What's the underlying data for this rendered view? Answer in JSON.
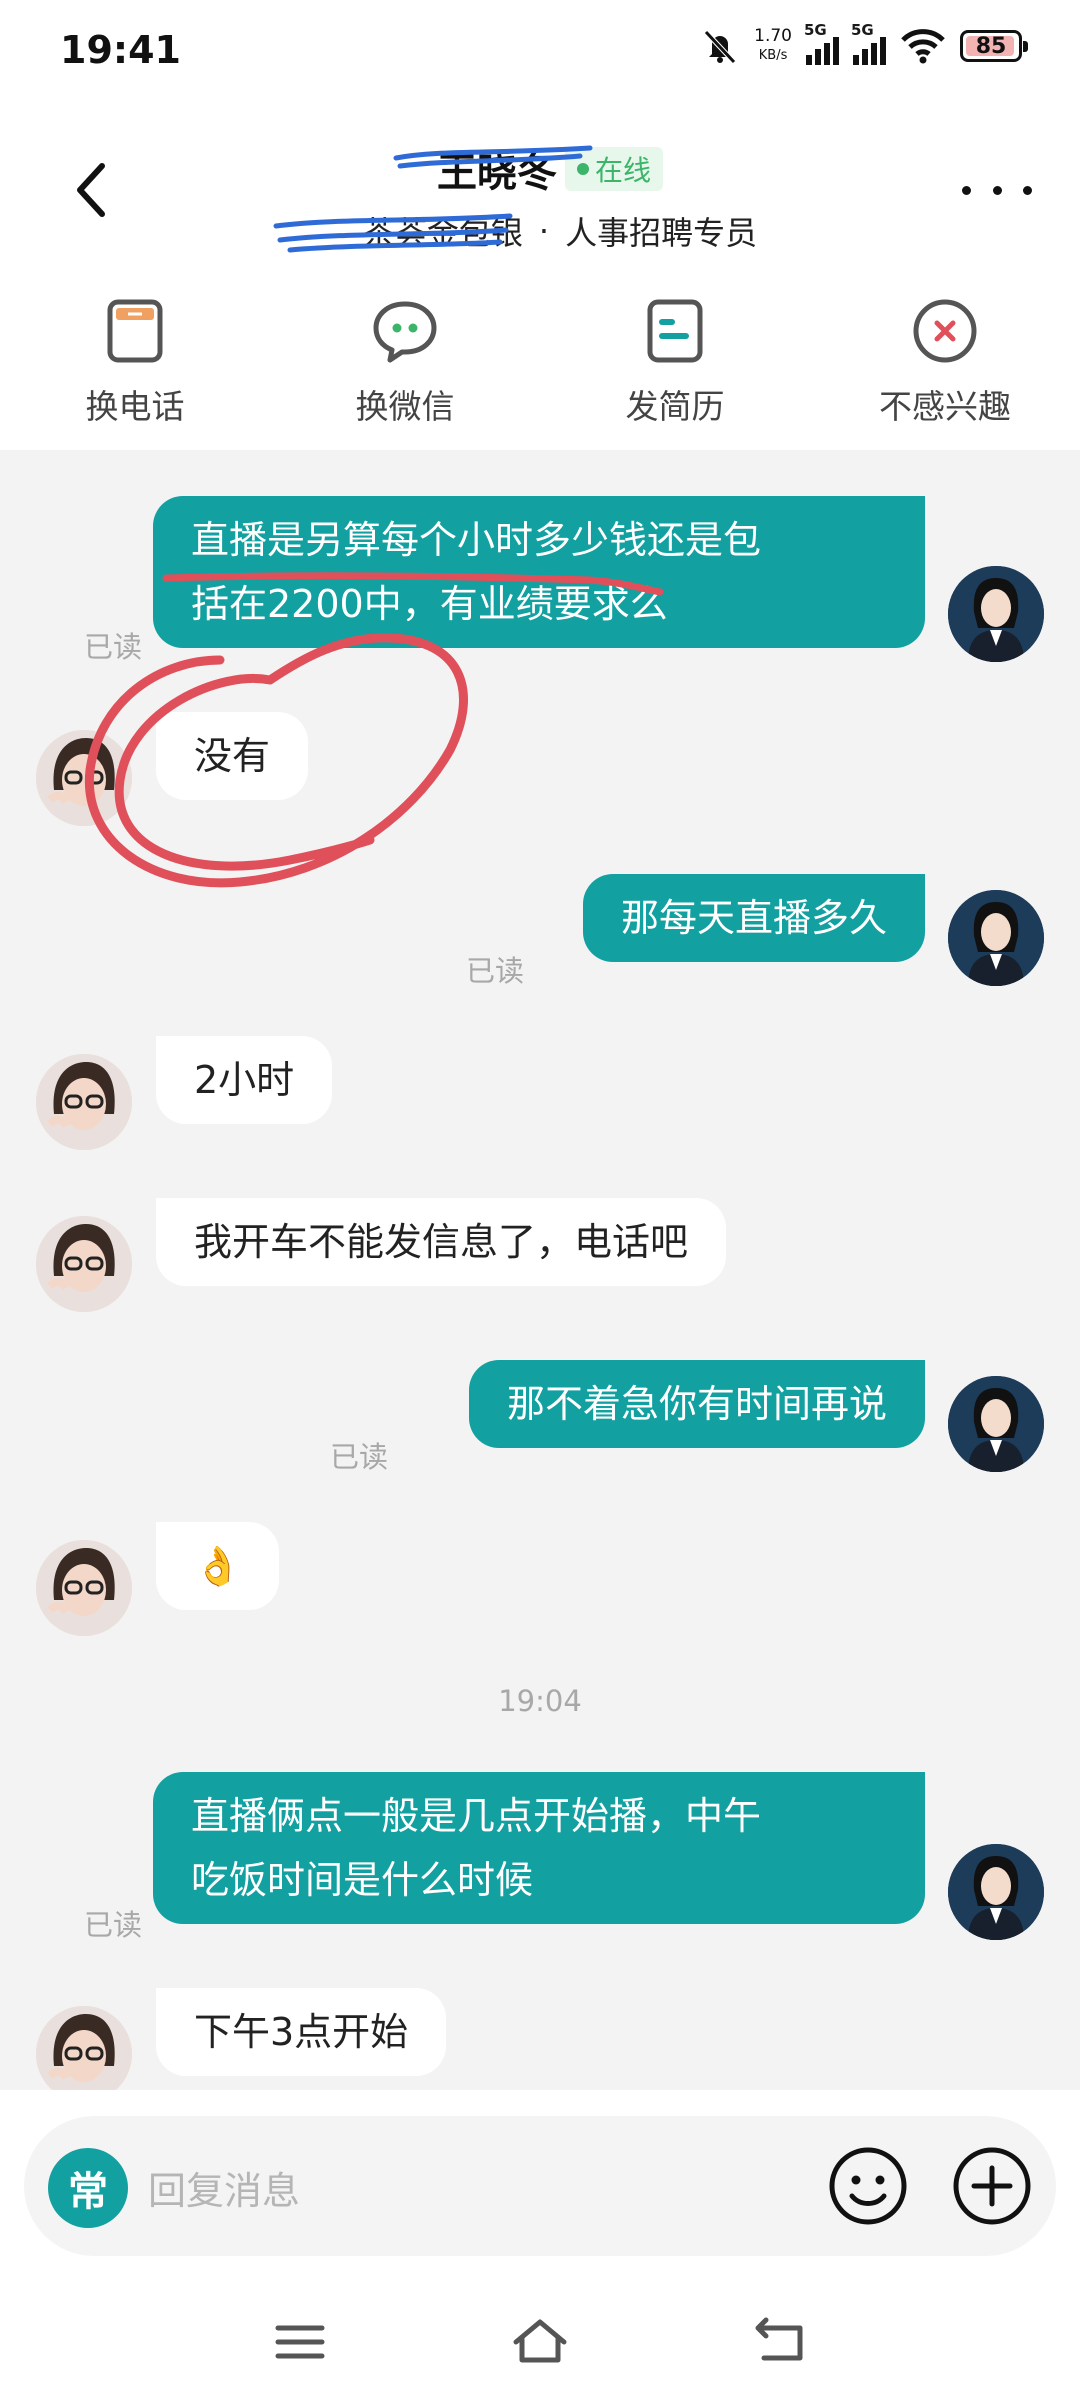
{
  "status_bar": {
    "time": "19:41",
    "net_speed": "1.70",
    "net_unit": "KB/s",
    "sim1": "5G",
    "sim2": "5G",
    "battery": "85"
  },
  "header": {
    "hr_name": "王晓冬",
    "online": "在线",
    "company": "茶荟金包银",
    "separator": "·",
    "job_title": "人事招聘专员"
  },
  "actions": [
    {
      "label": "换电话",
      "icon": "phone-swap-icon"
    },
    {
      "label": "换微信",
      "icon": "wechat-icon"
    },
    {
      "label": "发简历",
      "icon": "resume-icon"
    },
    {
      "label": "不感兴趣",
      "icon": "not-interested-icon"
    }
  ],
  "messages": [
    {
      "from": "me",
      "lines": [
        "直播是另算每个小时多少钱还是包",
        "括在2200中，有业绩要求么"
      ],
      "read": "已读"
    },
    {
      "from": "them",
      "lines": [
        "没有"
      ]
    },
    {
      "from": "me",
      "lines": [
        "那每天直播多久"
      ],
      "read": "已读"
    },
    {
      "from": "them",
      "lines": [
        "2小时"
      ]
    },
    {
      "from": "them",
      "lines": [
        "我开车不能发信息了，电话吧"
      ]
    },
    {
      "from": "me",
      "lines": [
        "那不着急你有时间再说"
      ],
      "read": "已读"
    },
    {
      "from": "them",
      "lines": [
        "👌"
      ]
    },
    {
      "timestamp": "19:04"
    },
    {
      "from": "me",
      "lines": [
        "直播俩点一般是几点开始播，中午",
        "吃饭时间是什么时候"
      ],
      "read": "已读"
    },
    {
      "from": "them",
      "lines": [
        "下午3点开始"
      ]
    }
  ],
  "input": {
    "quick_label": "常",
    "placeholder": "回复消息"
  },
  "colors": {
    "accent": "#13a0a0",
    "online": "#3cb56a",
    "annotation": "#e0505a",
    "scribble": "#2f6bd6"
  }
}
